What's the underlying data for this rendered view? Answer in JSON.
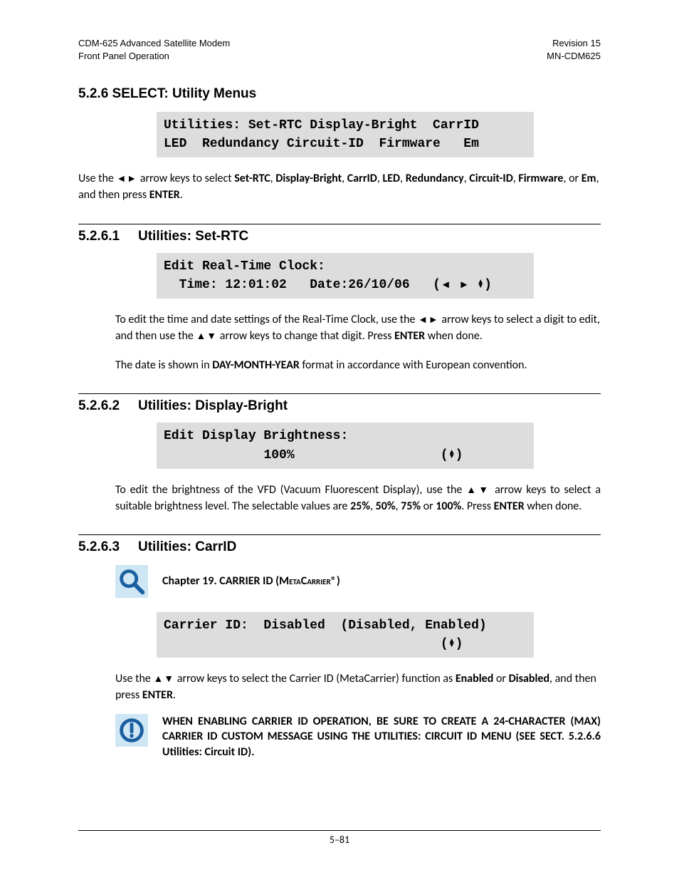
{
  "header": {
    "left_line1": "CDM-625 Advanced Satellite Modem",
    "left_line2": "Front Panel Operation",
    "right_line1": "Revision 15",
    "right_line2": "MN-CDM625"
  },
  "main_heading": "5.2.6  SELECT: Utility Menus",
  "lcd1_l1": "Utilities: Set-RTC Display-Bright  CarrID",
  "lcd1_l2": "LED  Redundancy Circuit-ID  Firmware   Em",
  "para1_a": "Use the ",
  "para1_b": " arrow keys to select ",
  "para1_items": [
    "Set-RTC",
    "Display-Bright",
    "CarrID",
    "LED",
    "Redundancy",
    "Circuit-ID",
    "Firmware",
    "Em"
  ],
  "para1_c": ", and then press ",
  "para1_d": "ENTER",
  "section1": {
    "num": "5.2.6.1",
    "title": "Utilities: Set-RTC"
  },
  "lcd2_l1": "Edit Real-Time Clock:",
  "lcd2_l2a": "  Time: 12:01:02   Date:26/10/06   (",
  "lcd2_l2b": ")",
  "para2_a": "To edit the time and date settings of the Real-Time Clock, use the ",
  "para2_b": " arrow keys to select a digit to edit, and then use the ",
  "para2_c": " arrow keys to change that digit. Press ",
  "para2_d": "ENTER",
  "para2_e": " when done.",
  "para3_a": "The date is shown in ",
  "para3_b": "DAY-MONTH-YEAR",
  "para3_c": " format in accordance with European convention.",
  "section2": {
    "num": "5.2.6.2",
    "title": "Utilities: Display-Bright"
  },
  "lcd3_l1": "Edit Display Brightness:",
  "lcd3_l2a": "             100%                   (",
  "lcd3_l2b": ")",
  "para4_a": "To edit the brightness of the VFD (Vacuum Fluorescent Display), use the ",
  "para4_b": " arrow keys to select a suitable brightness level. The selectable values are ",
  "para4_vals": [
    "25%",
    "50%",
    "75%",
    "100%"
  ],
  "para4_c": " Press ",
  "para4_d": "ENTER",
  "para4_e": " when done.",
  "section3": {
    "num": "5.2.6.3",
    "title": "Utilities: CarrID"
  },
  "ref_a": "Chapter 19. CARRIER ID (",
  "ref_b": "MetaCarrier",
  "ref_c": "®)",
  "lcd4_l1": "Carrier ID:  Disabled  (Disabled, Enabled)",
  "lcd4_l2a": "                                    (",
  "lcd4_l2b": ")",
  "para5_a": "Use the ",
  "para5_b": " arrow keys to select the Carrier ID (MetaCarrier) function as ",
  "para5_c": "Enabled",
  "para5_d": " or ",
  "para5_e": "Disabled",
  "para5_f": ", and then press ",
  "para5_g": "ENTER",
  "warn": "WHEN ENABLING CARRIER ID OPERATION, BE SURE TO CREATE A 24-CHARACTER (MAX) CARRIER ID CUSTOM MESSAGE USING THE UTILITIES: CIRCUIT ID MENU (SEE SECT. 5.2.6.6 Utilities: Circuit ID).",
  "page_number": "5–81",
  "glyph_lr": "◄►",
  "glyph_ud": "▲▼",
  "glyph_l": "◄",
  "glyph_r": "►",
  "glyph_updown_small": "▲▼"
}
